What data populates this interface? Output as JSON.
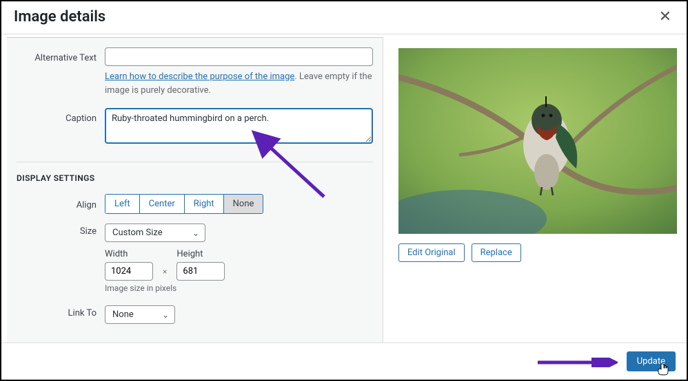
{
  "header": {
    "title": "Image details"
  },
  "form": {
    "alt_label": "Alternative Text",
    "alt_value": "",
    "alt_help_link": "Learn how to describe the purpose of the image",
    "alt_help_rest": ". Leave empty if the image is purely decorative.",
    "caption_label": "Caption",
    "caption_value": "Ruby-throated hummingbird on a perch."
  },
  "display": {
    "section_title": "DISPLAY SETTINGS",
    "align_label": "Align",
    "align_options": [
      "Left",
      "Center",
      "Right",
      "None"
    ],
    "align_selected": "None",
    "size_label": "Size",
    "size_value": "Custom Size",
    "width_label": "Width",
    "width_value": "1024",
    "wh_sep": "×",
    "height_label": "Height",
    "height_value": "681",
    "wh_help": "Image size in pixels",
    "linkto_label": "Link To",
    "linkto_value": "None"
  },
  "right": {
    "edit_original": "Edit Original",
    "replace": "Replace"
  },
  "footer": {
    "update": "Update"
  }
}
